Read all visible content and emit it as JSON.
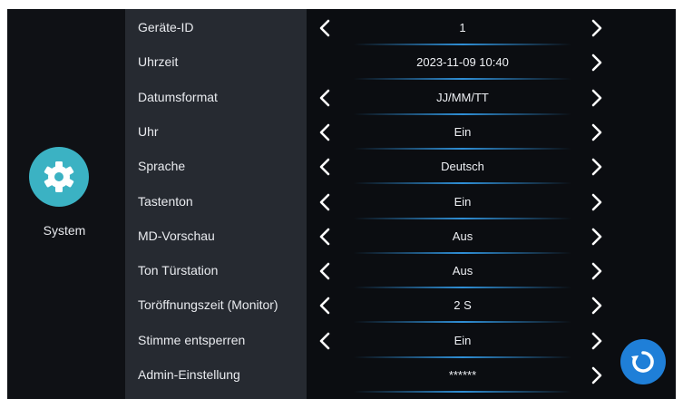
{
  "sidebar": {
    "label": "System",
    "icon": "gear-icon"
  },
  "settings": [
    {
      "label": "Geräte-ID",
      "value": "1",
      "left_arrow": true,
      "right_arrow": true
    },
    {
      "label": "Uhrzeit",
      "value": "2023-11-09  10:40",
      "left_arrow": false,
      "right_arrow": true
    },
    {
      "label": "Datumsformat",
      "value": "JJ/MM/TT",
      "left_arrow": true,
      "right_arrow": true
    },
    {
      "label": "Uhr",
      "value": "Ein",
      "left_arrow": true,
      "right_arrow": true
    },
    {
      "label": "Sprache",
      "value": "Deutsch",
      "left_arrow": true,
      "right_arrow": true
    },
    {
      "label": "Tastenton",
      "value": "Ein",
      "left_arrow": true,
      "right_arrow": true
    },
    {
      "label": "MD-Vorschau",
      "value": "Aus",
      "left_arrow": true,
      "right_arrow": true
    },
    {
      "label": "Ton Türstation",
      "value": "Aus",
      "left_arrow": true,
      "right_arrow": true
    },
    {
      "label": "Toröffnungszeit (Monitor)",
      "value": "2 S",
      "left_arrow": true,
      "right_arrow": true
    },
    {
      "label": "Stimme entsperren",
      "value": "Ein",
      "left_arrow": true,
      "right_arrow": true
    },
    {
      "label": "Admin-Einstellung",
      "value": "******",
      "left_arrow": false,
      "right_arrow": true
    }
  ],
  "reset_button": {
    "icon": "refresh-icon"
  },
  "colors": {
    "accent": "#1f7fd8",
    "system_icon": "#3bb2c3",
    "separator": "#2f8fd6"
  }
}
